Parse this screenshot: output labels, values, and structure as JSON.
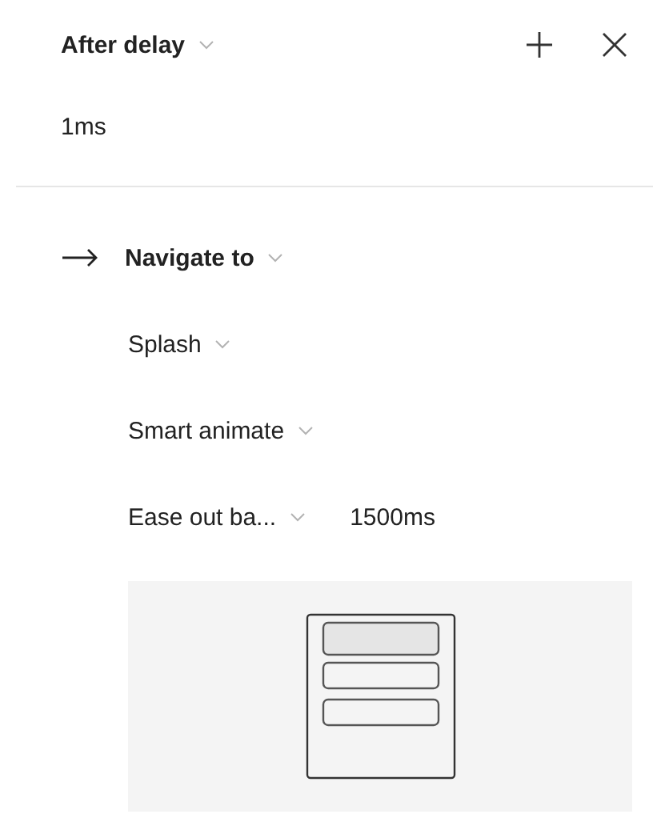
{
  "trigger": {
    "label": "After delay",
    "delay": "1ms"
  },
  "action": {
    "label": "Navigate to",
    "destination": "Splash",
    "animation": "Smart animate",
    "easing": "Ease out ba...",
    "duration": "1500ms"
  },
  "preview": {
    "kind": "screen-drawing"
  }
}
